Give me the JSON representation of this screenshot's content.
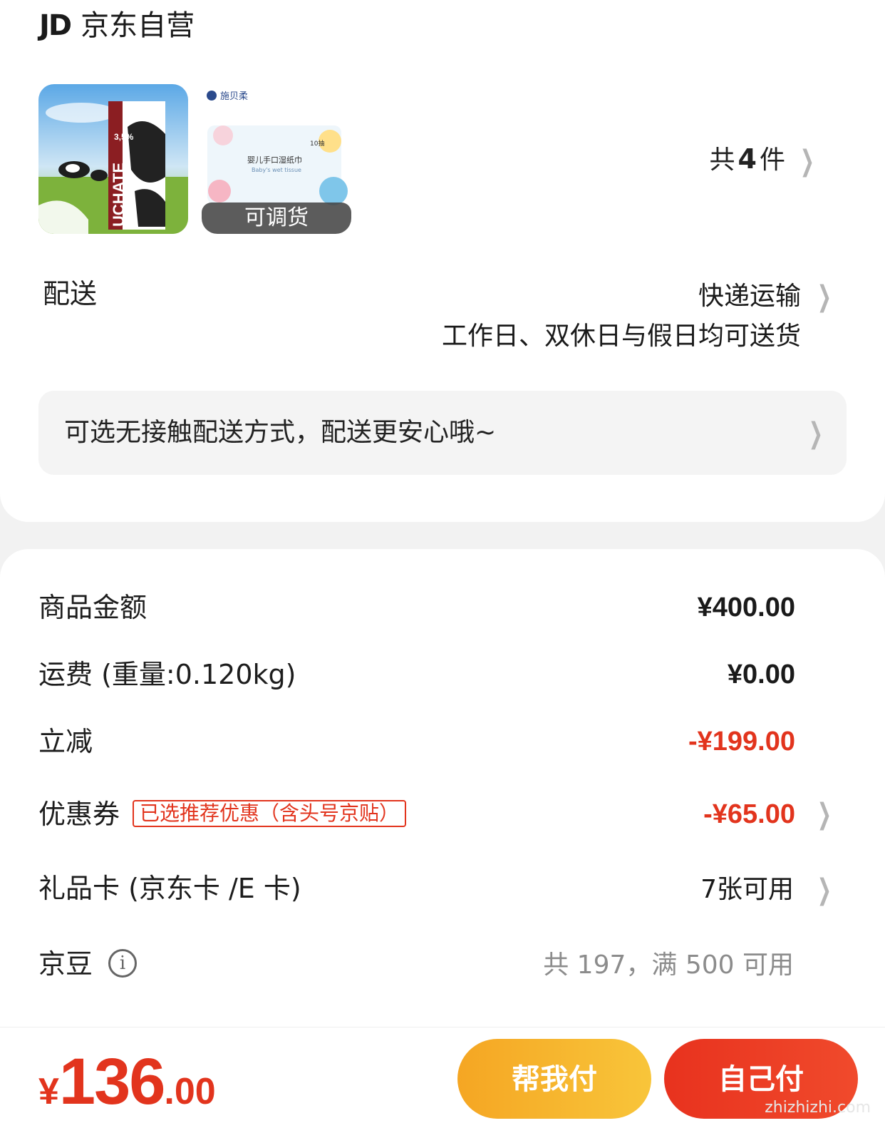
{
  "shop": {
    "logo_text": "JD",
    "name": "京东自营"
  },
  "products": {
    "milk_image": "milk-carton-product-image",
    "wipes_image": "baby-wet-wipes-product-image",
    "wipes_brand_text": "施贝柔",
    "wipes_pack_title": "婴儿手口湿纸巾",
    "wipes_pack_subtitle": "Baby's wet tissue",
    "wipes_pack_count": "10抽",
    "milk_pack_fat": "3,5%",
    "milk_pack_name": "UCHATE",
    "wipes_tag": "可调货",
    "count_prefix": "共",
    "count_number": "4",
    "count_suffix": "件"
  },
  "delivery": {
    "label": "配送",
    "method": "快递运输",
    "schedule": "工作日、双休日与假日均可送货",
    "notice": "可选无接触配送方式，配送更安心哦~"
  },
  "summary": {
    "items_label": "商品金额",
    "items_value": "¥400.00",
    "shipping_label": "运费 (重量:0.120kg)",
    "shipping_value": "¥0.00",
    "discount_label": "立减",
    "discount_value": "-¥199.00",
    "coupon_label": "优惠券",
    "coupon_tag": "已选推荐优惠（含头号京贴）",
    "coupon_value": "-¥65.00",
    "giftcard_label": "礼品卡 (京东卡 /E 卡)",
    "giftcard_value": "7张可用",
    "beans_label": "京豆",
    "beans_value": "共 197，满 500 可用"
  },
  "footer": {
    "currency": "¥",
    "total_int": "136",
    "total_dec": ".00",
    "help_pay": "帮我付",
    "self_pay": "自己付",
    "watermark": "zhizhizhi.com"
  },
  "colors": {
    "accent_red": "#e2341d",
    "help_orange": "#f5a623"
  }
}
